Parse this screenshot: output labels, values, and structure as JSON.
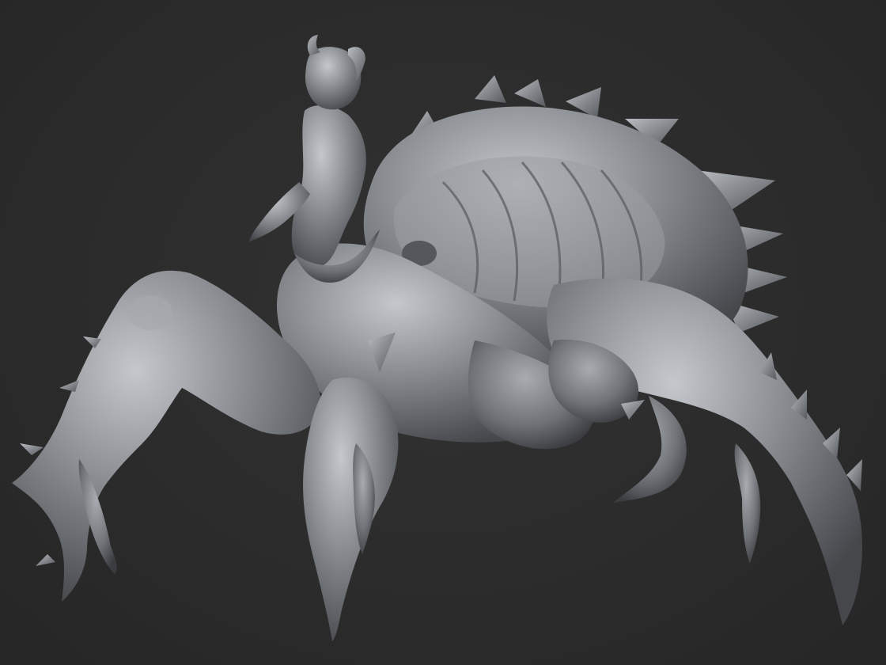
{
  "viewport": {
    "background_color": "#2c2c2c",
    "material_color": "#8a8d92",
    "material_shadow": "#3c3e42",
    "material_highlight": "#c9ccd1"
  },
  "sculpt": {
    "subject": "creature-sculpt",
    "parts": [
      "rider",
      "abdomen",
      "thorax",
      "front-left-leg",
      "front-right-leg",
      "mid-leg",
      "rear-leg",
      "back-spikes"
    ]
  }
}
